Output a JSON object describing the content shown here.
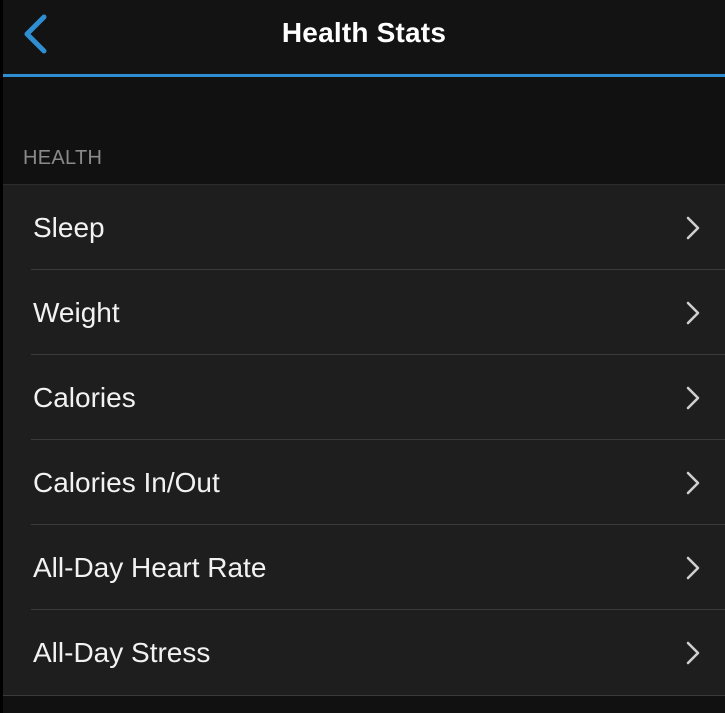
{
  "header": {
    "title": "Health Stats",
    "back_icon": "chevron-left-icon",
    "accent_color": "#2f8ed2"
  },
  "section": {
    "title": "HEALTH"
  },
  "items": [
    {
      "label": "Sleep",
      "icon": "chevron-right-icon"
    },
    {
      "label": "Weight",
      "icon": "chevron-right-icon"
    },
    {
      "label": "Calories",
      "icon": "chevron-right-icon"
    },
    {
      "label": "Calories In/Out",
      "icon": "chevron-right-icon"
    },
    {
      "label": "All-Day Heart Rate",
      "icon": "chevron-right-icon"
    },
    {
      "label": "All-Day Stress",
      "icon": "chevron-right-icon"
    }
  ]
}
